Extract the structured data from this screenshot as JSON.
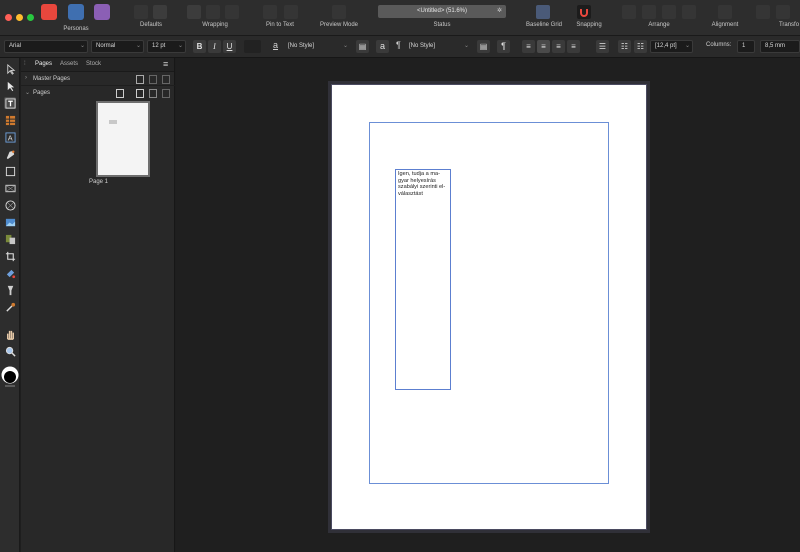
{
  "toolbar": {
    "personas_label": "Personas",
    "defaults_label": "Defaults",
    "wrapping_label": "Wrapping",
    "pin_to_text_label": "Pin to Text",
    "preview_mode_label": "Preview Mode",
    "status_label": "Status",
    "status_text": "<Untitled> (51.6%)",
    "baseline_grid_label": "Baseline Grid",
    "snapping_label": "Snapping",
    "arrange_label": "Arrange",
    "alignment_label": "Alignment",
    "transform_label": "Transfo",
    "accent_color": "#e8473d"
  },
  "context_toolbar": {
    "font_family": "Arial",
    "font_style": "Normal",
    "font_size": "12 pt",
    "bold": "B",
    "italic": "I",
    "underline": "U",
    "char_style_glyph": "a",
    "char_style": "[No Style]",
    "para_glyph": "¶",
    "para_style": "[No Style]",
    "leading": "[12,4 pt]",
    "columns_label": "Columns:",
    "columns_value": "1",
    "gutter_value": "8,5 mm"
  },
  "panel": {
    "tabs": [
      "Pages",
      "Assets",
      "Stock"
    ],
    "master_pages_label": "Master Pages",
    "pages_label": "Pages",
    "page_thumb_label": "Page 1"
  },
  "canvas": {
    "text_frame_content": "Igen, tudja a ma-gyar helyesírás szabályi szerinti el-választást"
  }
}
